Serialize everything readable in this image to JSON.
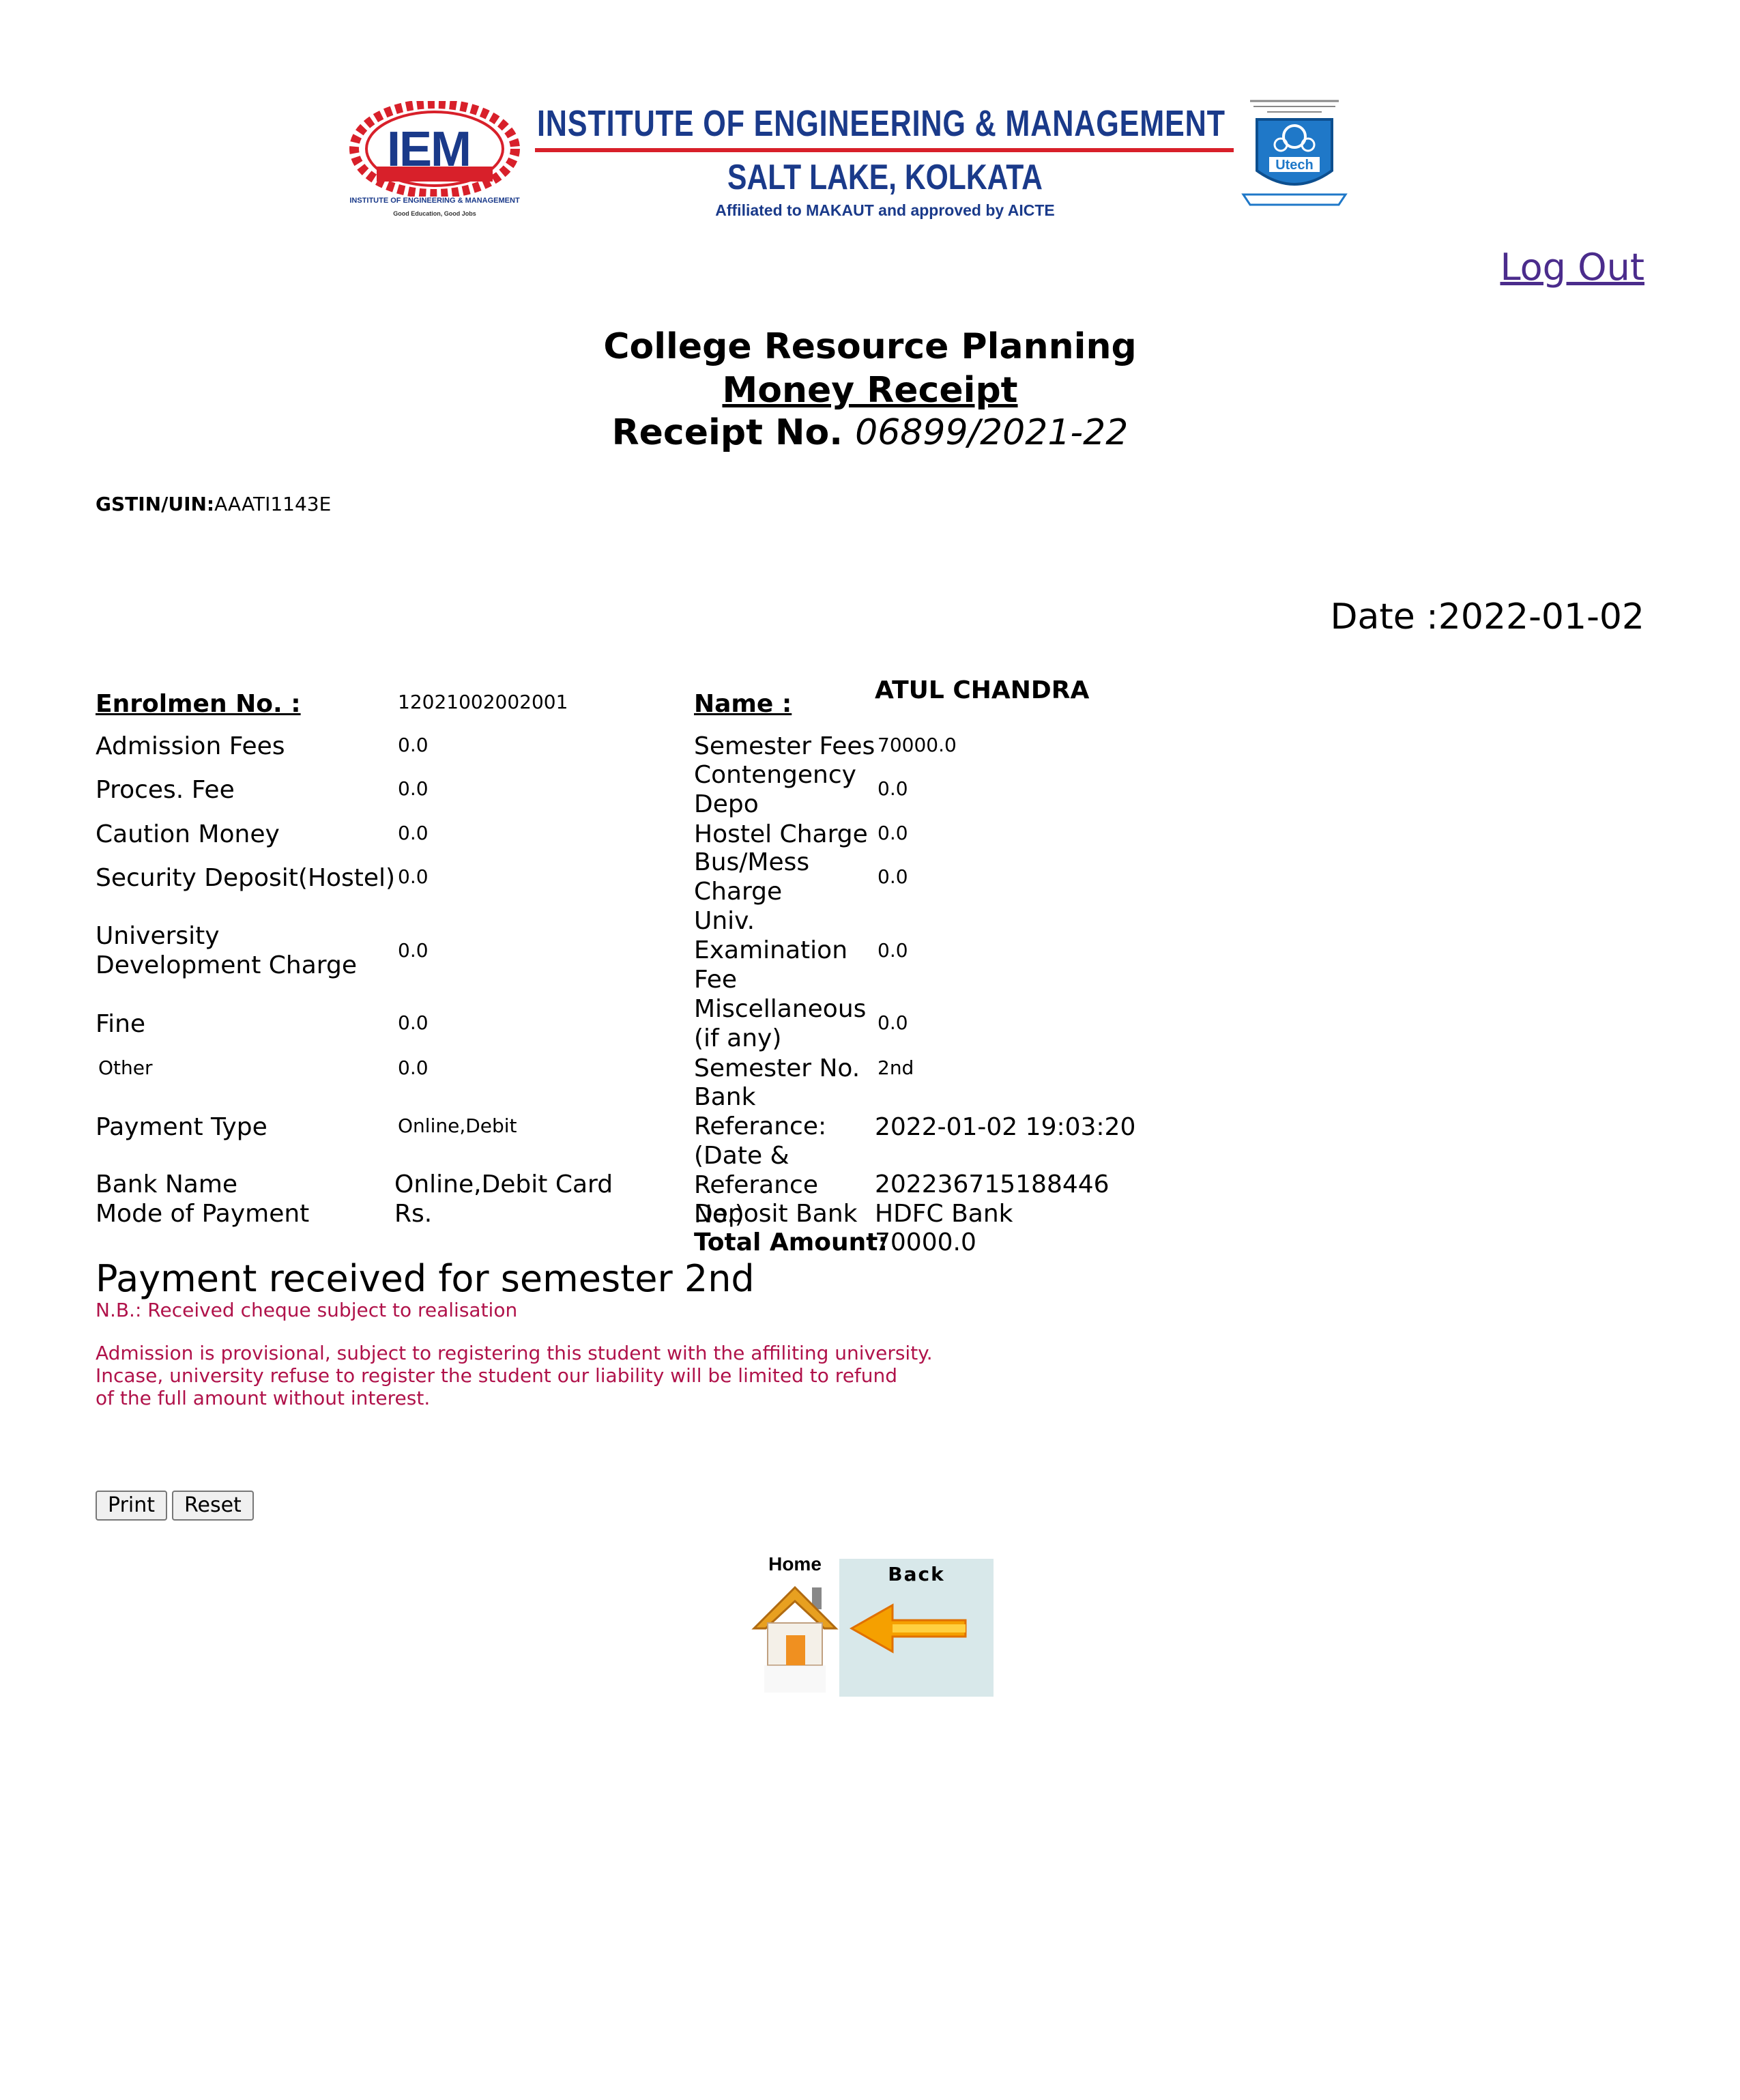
{
  "header": {
    "logo_text": "IEM",
    "logo_caption": "INSTITUTE OF ENGINEERING & MANAGEMENT",
    "logo_tagline": "Good Education, Good Jobs",
    "institute_name": "INSTITUTE OF ENGINEERING & MANAGEMENT",
    "location": "SALT LAKE, KOLKATA",
    "affiliation": "Affiliated to MAKAUT and approved by AICTE",
    "university_logo_text": "Utech"
  },
  "nav": {
    "logout_label": "Log Out"
  },
  "title": {
    "line1": "College Resource Planning",
    "line2": "Money Receipt",
    "receipt_label": "Receipt No.",
    "receipt_no": "06899/2021-22"
  },
  "gstin": {
    "label": "GSTIN/UIN:",
    "value": "AAATI1143E"
  },
  "date": {
    "label": "Date :",
    "value": "2022-01-02"
  },
  "receipt": {
    "enrolment_label": "Enrolmen No. :",
    "enrolment_value": "12021002002001",
    "name_label": "Name :",
    "name_value": "ATUL CHANDRA",
    "left_rows": [
      {
        "label": "Admission Fees",
        "value": "0.0"
      },
      {
        "label": "Proces. Fee",
        "value": "0.0"
      },
      {
        "label": "Caution Money",
        "value": "0.0"
      },
      {
        "label": "Security Deposit(Hostel)",
        "value": "0.0"
      },
      {
        "label": "University Development Charge",
        "value": "0.0"
      },
      {
        "label": "Fine",
        "value": "0.0"
      },
      {
        "label": "Other",
        "value": "0.0"
      },
      {
        "label": "Payment Type",
        "value": "Online,Debit"
      },
      {
        "label": "Bank Name",
        "value": "Online,Debit Card"
      },
      {
        "label": "Mode of Payment",
        "value": "Rs."
      }
    ],
    "right_rows": [
      {
        "label": "Semester Fees",
        "value": "70000.0"
      },
      {
        "label": "Contengency Depo",
        "value": "0.0"
      },
      {
        "label": "Hostel Charge",
        "value": "0.0"
      },
      {
        "label": "Bus/Mess Charge",
        "value": "0.0"
      },
      {
        "label": "Univ. Examination Fee",
        "value": "0.0"
      },
      {
        "label": "Miscellaneous(if any)",
        "value": "0.0"
      },
      {
        "label": "Semester No.",
        "value": "2nd"
      },
      {
        "label": "Bank Referance: (Date & Referance No.)",
        "value": "2022-01-02 19:03:20"
      },
      {
        "label": "",
        "value": "202236715188446"
      },
      {
        "label": "Deposit Bank",
        "value": "HDFC Bank"
      },
      {
        "label": "Total Amount:",
        "value": "70000.0"
      }
    ]
  },
  "messages": {
    "payment_received": "Payment received for semester 2nd",
    "nb": "N.B.: Received cheque subject to realisation",
    "provisional_1": "Admission is provisional, subject to registering this student with the affiliting university.",
    "provisional_2": "Incase, university refuse to register the student our liability will be limited to refund",
    "provisional_3": "of the full amount without interest."
  },
  "buttons": {
    "print": "Print",
    "reset": "Reset"
  },
  "bottom_nav": {
    "home": "Home",
    "back": "Back"
  },
  "colors": {
    "institute_blue": "#1a3a8a",
    "accent_red": "#d8202a",
    "note_red": "#b0124a",
    "link_purple": "#4b2c8c"
  }
}
